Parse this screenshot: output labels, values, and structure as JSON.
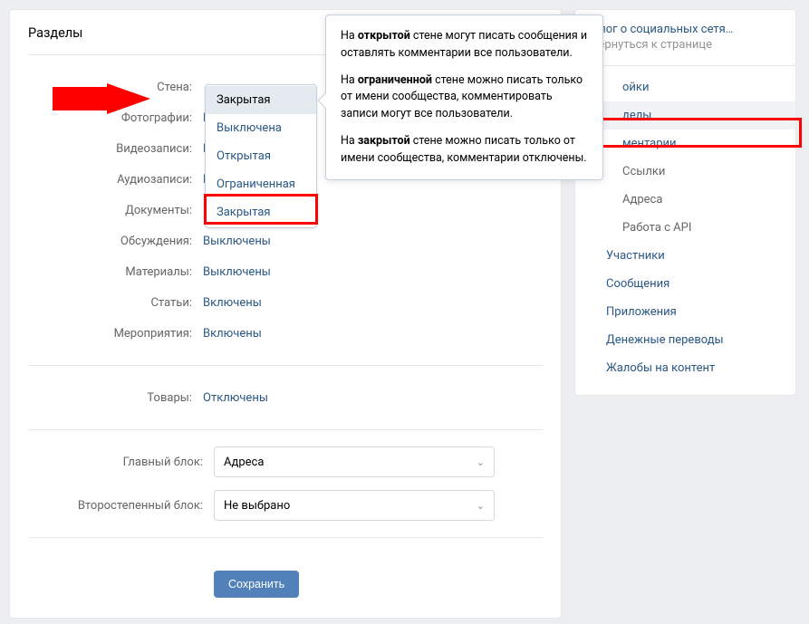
{
  "page_title": "Разделы",
  "arrow_color": "#ff0000",
  "settings": [
    {
      "label": "Стена:",
      "value": "Закрытая"
    },
    {
      "label": "Фотографии:",
      "value": "Выключены"
    },
    {
      "label": "Видеозаписи:",
      "value": "Выключены"
    },
    {
      "label": "Аудиозаписи:",
      "value": "Выключены"
    },
    {
      "label": "Документы:",
      "value": "Выключены"
    },
    {
      "label": "Обсуждения:",
      "value": "Выключены"
    },
    {
      "label": "Материалы:",
      "value": "Выключены"
    },
    {
      "label": "Статьи:",
      "value": "Включены"
    },
    {
      "label": "Мероприятия:",
      "value": "Включены"
    }
  ],
  "goods": {
    "label": "Товары:",
    "value": "Отключены"
  },
  "blocks": {
    "main": {
      "label": "Главный блок:",
      "value": "Адреса"
    },
    "secondary": {
      "label": "Второстепенный блок:",
      "value": "Не выбрано"
    }
  },
  "save_label": "Сохранить",
  "dropdown": {
    "selected": "Закрытая",
    "options": [
      "Выключена",
      "Открытая",
      "Ограниченная",
      "Закрытая"
    ]
  },
  "tooltip": {
    "p1a": "На ",
    "p1b": "открытой",
    "p1c": " стене могут писать сообщения и оставлять комментарии все пользователи.",
    "p2a": "На ",
    "p2b": "ограниченной",
    "p2c": " стене можно писать только от имени сообщества, комментировать записи могут все пользователи.",
    "p3a": "На ",
    "p3b": "закрытой",
    "p3c": " стене можно писать только от имени сообщества, комментарии отключены."
  },
  "sidebar": {
    "blog": "Блог о социальных сетя…",
    "back": "вернуться к странице",
    "items": [
      {
        "text": "ойки",
        "indent": true
      },
      {
        "text": "делы",
        "indent": true,
        "active": true
      },
      {
        "text": "ментарии",
        "indent": true
      },
      {
        "text": "Ссылки",
        "indent": true,
        "gray": true
      },
      {
        "text": "Адреса",
        "indent": true,
        "gray": true
      },
      {
        "text": "Работа с API",
        "indent": true,
        "gray": true
      },
      {
        "text": "Участники",
        "indent": false
      },
      {
        "text": "Сообщения",
        "indent": false
      },
      {
        "text": "Приложения",
        "indent": false
      },
      {
        "text": "Денежные переводы",
        "indent": false
      },
      {
        "text": "Жалобы на контент",
        "indent": false
      }
    ]
  }
}
